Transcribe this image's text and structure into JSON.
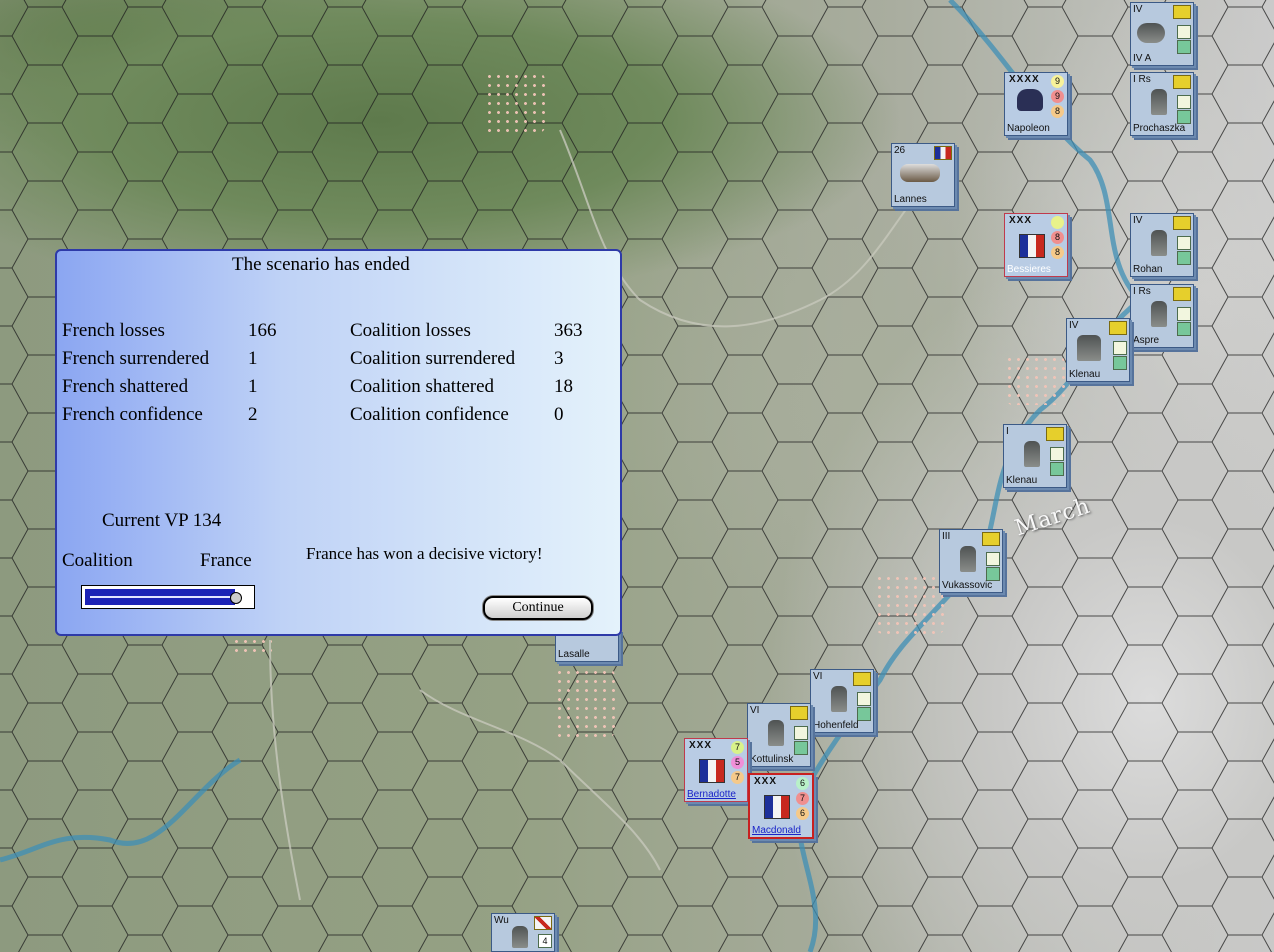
{
  "map": {
    "label": "March",
    "units": [
      {
        "name": "IV A",
        "rank": "IV",
        "side": "coalition"
      },
      {
        "name": "Prochaszka",
        "rank": "I Rs",
        "side": "coalition"
      },
      {
        "name": "Napoleon",
        "rank": "XXXX",
        "side": "french",
        "ratings": [
          "9",
          "9",
          "8"
        ]
      },
      {
        "name": "Lannes",
        "rank": "26",
        "side": "french"
      },
      {
        "name": "Bessieres",
        "rank": "XXX",
        "side": "french",
        "ratings": [
          "",
          "8",
          "8"
        ]
      },
      {
        "name": "Rohan",
        "rank": "IV",
        "side": "coalition"
      },
      {
        "name": "Aspre",
        "rank": "I Rs",
        "side": "coalition"
      },
      {
        "name": "Klenau",
        "rank": "IV",
        "side": "coalition"
      },
      {
        "name": "Klenau",
        "rank": "I",
        "side": "coalition"
      },
      {
        "name": "Vukassovic",
        "rank": "III",
        "side": "coalition"
      },
      {
        "name": "Hohenfeld",
        "rank": "VI",
        "side": "coalition"
      },
      {
        "name": "Kottulinsk",
        "rank": "VI",
        "side": "coalition"
      },
      {
        "name": "Bernadotte",
        "rank": "XXX",
        "side": "french",
        "ratings": [
          "7",
          "5",
          "7"
        ]
      },
      {
        "name": "Macdonald",
        "rank": "XXX",
        "side": "french",
        "ratings": [
          "6",
          "7",
          "6"
        ]
      },
      {
        "name": "Lasalle",
        "rank": "",
        "side": "french"
      },
      {
        "name": "Wu",
        "rank": "",
        "side": "coalition",
        "strength": "4"
      }
    ]
  },
  "dialog": {
    "title": "The scenario has ended",
    "french": [
      {
        "label": "French losses",
        "value": "166"
      },
      {
        "label": "French surrendered",
        "value": "1"
      },
      {
        "label": "French shattered",
        "value": "1"
      },
      {
        "label": "French confidence",
        "value": "2"
      }
    ],
    "coalition": [
      {
        "label": "Coalition losses",
        "value": "363"
      },
      {
        "label": "Coalition surrendered",
        "value": "3"
      },
      {
        "label": "Coalition shattered",
        "value": "18"
      },
      {
        "label": "Coalition confidence",
        "value": "0"
      }
    ],
    "current_vp": "Current VP 134",
    "vp_left": "Coalition",
    "vp_right": "France",
    "vp_position": 0.95,
    "result": "France has won a decisive victory!",
    "continue_label": "Continue"
  },
  "colors": {
    "dialog_border": "#2e3aa8",
    "vp_bar": "#1c22b6",
    "french_label": "#1a24c8"
  }
}
